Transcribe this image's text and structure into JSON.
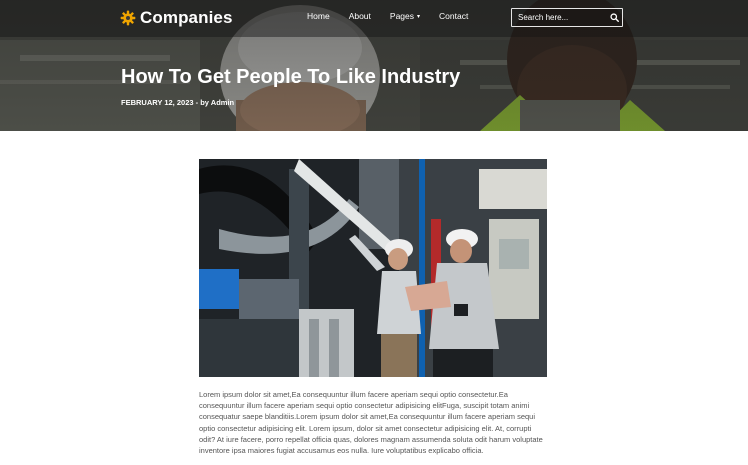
{
  "brand": {
    "name": "Companies",
    "icon": "gear-icon",
    "accent": "#f0a500"
  },
  "nav": {
    "items": [
      {
        "label": "Home"
      },
      {
        "label": "About"
      },
      {
        "label": "Pages",
        "has_dropdown": true
      },
      {
        "label": "Contact"
      }
    ]
  },
  "search": {
    "placeholder": "Search here...",
    "icon": "search-icon"
  },
  "hero": {
    "title": "How To Get People To Like Industry",
    "date": "FEBRUARY 12, 2023",
    "author_prefix": "- by",
    "author": "Admin"
  },
  "article": {
    "image_desc": "two-workers-in-hardhats-in-factory",
    "body": "Lorem ipsum dolor sit amet,Ea consequuntur illum facere aperiam sequi optio consectetur.Ea consequuntur illum facere aperiam sequi optio consectetur adipisicing elitFuga, suscipit totam animi consequatur saepe blanditiis.Lorem ipsum dolor sit amet,Ea consequuntur illum facere aperiam sequi optio consectetur adipisicing elit. Lorem ipsum, dolor sit amet consectetur adipisicing elit. At, corrupti odit? At iure facere, porro repellat officia quas, dolores magnam assumenda soluta odit harum voluptate inventore ipsa maiores fugiat accusamus eos nulla. Iure voluptatibus explicabo officia."
  }
}
